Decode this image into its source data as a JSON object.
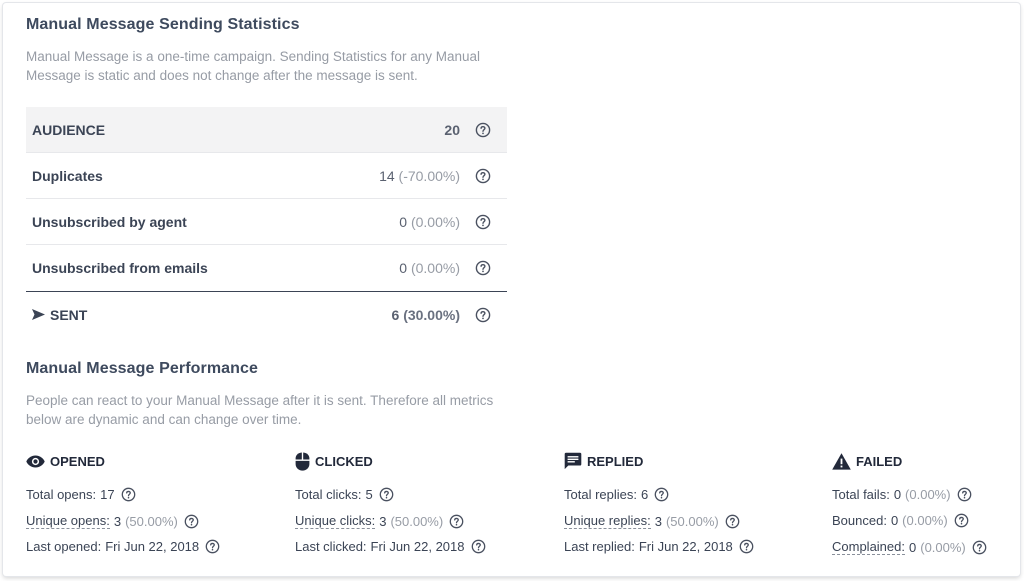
{
  "sending": {
    "title": "Manual Message Sending Statistics",
    "description": "Manual Message is a one-time campaign. Sending Statistics for any Manual Message is static and does not change after the message is sent.",
    "rows": [
      {
        "label": "AUDIENCE",
        "value": "20",
        "pct": ""
      },
      {
        "label": "Duplicates",
        "value": "14",
        "pct": "(-70.00%)"
      },
      {
        "label": "Unsubscribed by agent",
        "value": "0",
        "pct": "(0.00%)"
      },
      {
        "label": "Unsubscribed from emails",
        "value": "0",
        "pct": "(0.00%)"
      },
      {
        "label": "SENT",
        "value": "6",
        "pct": "(30.00%)"
      }
    ]
  },
  "performance": {
    "title": "Manual Message Performance",
    "description": "People can react to your Manual Message after it is sent. Therefore all metrics below are dynamic and can change over time.",
    "opened": {
      "heading": "OPENED",
      "total_label": "Total opens:",
      "total_value": "17",
      "unique_label": "Unique opens:",
      "unique_value": "3",
      "unique_pct": "(50.00%)",
      "last_label": "Last opened:",
      "last_value": "Fri Jun 22, 2018"
    },
    "clicked": {
      "heading": "CLICKED",
      "total_label": "Total clicks:",
      "total_value": "5",
      "unique_label": "Unique clicks:",
      "unique_value": "3",
      "unique_pct": "(50.00%)",
      "last_label": "Last clicked:",
      "last_value": "Fri Jun 22, 2018"
    },
    "replied": {
      "heading": "REPLIED",
      "total_label": "Total replies:",
      "total_value": "6",
      "unique_label": "Unique replies:",
      "unique_value": "3",
      "unique_pct": "(50.00%)",
      "last_label": "Last replied:",
      "last_value": "Fri Jun 22, 2018"
    },
    "failed": {
      "heading": "FAILED",
      "total_label": "Total fails:",
      "total_value": "0",
      "total_pct": "(0.00%)",
      "bounced_label": "Bounced:",
      "bounced_value": "0",
      "bounced_pct": "(0.00%)",
      "complained_label": "Complained:",
      "complained_value": "0",
      "complained_pct": "(0.00%)"
    }
  },
  "icons": {
    "help": "question-circle-icon",
    "sent": "send-arrow-icon",
    "opened": "eye-icon",
    "clicked": "mouse-icon",
    "replied": "chat-bubble-icon",
    "failed": "warning-triangle-icon"
  }
}
